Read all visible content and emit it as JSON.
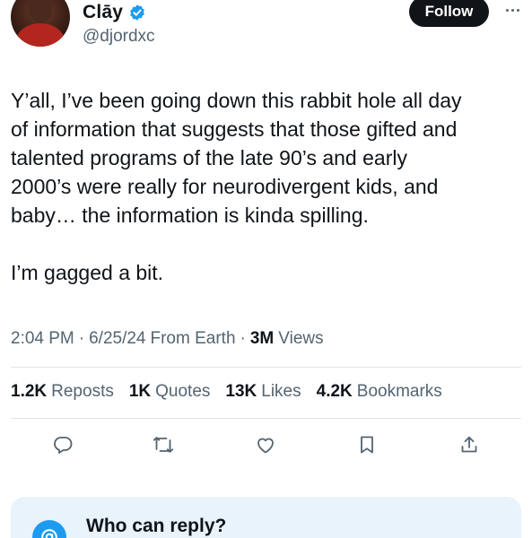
{
  "user": {
    "display_name": "Clāy",
    "handle": "@djordxc",
    "avatar_icon": "profile-photo",
    "verified_icon": "verified-badge-icon",
    "verified_color": "#1d9bf0"
  },
  "header": {
    "follow_label": "Follow",
    "more_icon": "more-horizontal-icon"
  },
  "tweet": {
    "paragraph_1": "Y’all, I’ve been going down this rabbit hole all day\nof information that suggests that those gifted and\ntalented programs of the late 90’s and early\n2000’s were really for neurodivergent kids, and\nbaby… the information is kinda spilling.",
    "paragraph_2": "I’m gagged a bit."
  },
  "meta": {
    "time": "2:04 PM",
    "date": "6/25/24",
    "location": "From Earth",
    "views_count": "3M",
    "views_label": "Views",
    "separator": "·"
  },
  "stats": {
    "reposts": {
      "count": "1.2K",
      "label": "Reposts"
    },
    "quotes": {
      "count": "1K",
      "label": "Quotes"
    },
    "likes": {
      "count": "13K",
      "label": "Likes"
    },
    "bookmarks": {
      "count": "4.2K",
      "label": "Bookmarks"
    }
  },
  "actions": [
    "reply-icon",
    "repost-icon",
    "like-icon",
    "bookmark-icon",
    "share-icon"
  ],
  "reply_card": {
    "title": "Who can reply?",
    "icon": "mention-icon",
    "accent": "#1d9bf0"
  },
  "colors": {
    "text_primary": "#0f1419",
    "text_secondary": "#536471",
    "divider": "#e1e6ea",
    "reply_card_bg": "#e8f3fc"
  }
}
